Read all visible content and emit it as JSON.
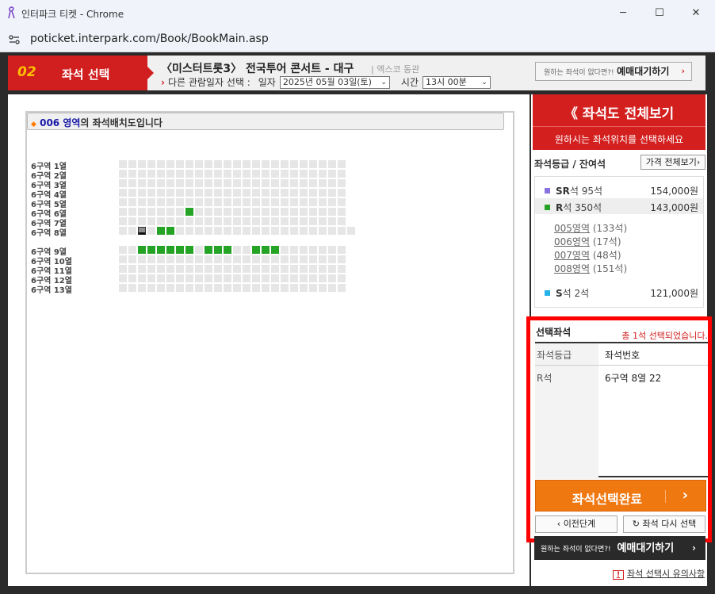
{
  "window": {
    "title": "인터파크 티켓 - Chrome",
    "url": "poticket.interpark.com/Book/BookMain.asp",
    "buttons": {
      "minimize": "─",
      "maximize": "☐",
      "close": "✕"
    }
  },
  "header": {
    "step_number": "02",
    "step_label": "좌석 선택",
    "show_title": "〈미스터트롯3〉 전국투어 콘서트 - 대구",
    "venue": "| 엑스코 동관",
    "date_prefix": "다른 관람일자 선택 :",
    "date_label": "일자",
    "date_value": "2025년 05월 03일(토)",
    "time_label": "시간",
    "time_value": "13시 00분",
    "waitlist_small": "원하는 좌석이 없다면?!",
    "waitlist_label": "예매대기하기",
    "waitlist_arrow": "›"
  },
  "seat_map": {
    "zone_title": "006 영역",
    "zone_title_rest": "의 좌석배치도입니다",
    "rows": [
      "6구역 1열",
      "6구역 2열",
      "6구역 3열",
      "6구역 4열",
      "6구역 5열",
      "6구역 6열",
      "6구역 7열",
      "6구역 8열",
      "6구역 9열",
      "6구역 10열",
      "6구역 11열",
      "6구역 12열",
      "6구역 13열"
    ],
    "seats_per_row": 24,
    "available": {
      "5": [
        7
      ],
      "7": [
        2,
        4,
        5
      ],
      "8": [
        2,
        3,
        4,
        5,
        6,
        7,
        9,
        10,
        11,
        14,
        15,
        16
      ]
    },
    "selected_seat": {
      "row": 7,
      "col": 2
    }
  },
  "sidebar": {
    "full_map_label": "《 좌석도 전체보기",
    "full_map_sub": "원하시는 좌석위치를 선택하세요",
    "grade_heading": "좌석등급 / 잔여석",
    "price_all": "가격 전체보기›",
    "grades": [
      {
        "grade": "SR",
        "suffix": "석",
        "remain": "95석",
        "price": "154,000원",
        "color": "#8a73e0"
      },
      {
        "grade": "R",
        "suffix": "석",
        "remain": "350석",
        "price": "143,000원",
        "color": "#24a324"
      },
      {
        "grade": "S",
        "suffix": "석",
        "remain": "2석",
        "price": "121,000원",
        "color": "#27b3e8"
      }
    ],
    "zones": [
      {
        "name": "005영역",
        "count": "(133석)"
      },
      {
        "name": "006영역",
        "count": "(17석)"
      },
      {
        "name": "007영역",
        "count": "(48석)"
      },
      {
        "name": "008영역",
        "count": "(151석)"
      }
    ]
  },
  "selected": {
    "title": "선택좌석",
    "count_text": "총 1석 선택되었습니다.",
    "col_grade": "좌석등급",
    "col_seat": "좌석번호",
    "grade": "R석",
    "seat": "6구역 8열 22",
    "complete_label": "좌석선택완료",
    "complete_arrow": "›",
    "prev_label": "‹ 이전단계",
    "reset_label": "↻ 좌석 다시 선택"
  },
  "bottom": {
    "waitlist_small": "원하는 좌석이 없다면?!",
    "waitlist_label": "예매대기하기",
    "waitlist_arrow": "›",
    "notice_icon": "!",
    "notice": "좌석 선택시 유의사항"
  }
}
